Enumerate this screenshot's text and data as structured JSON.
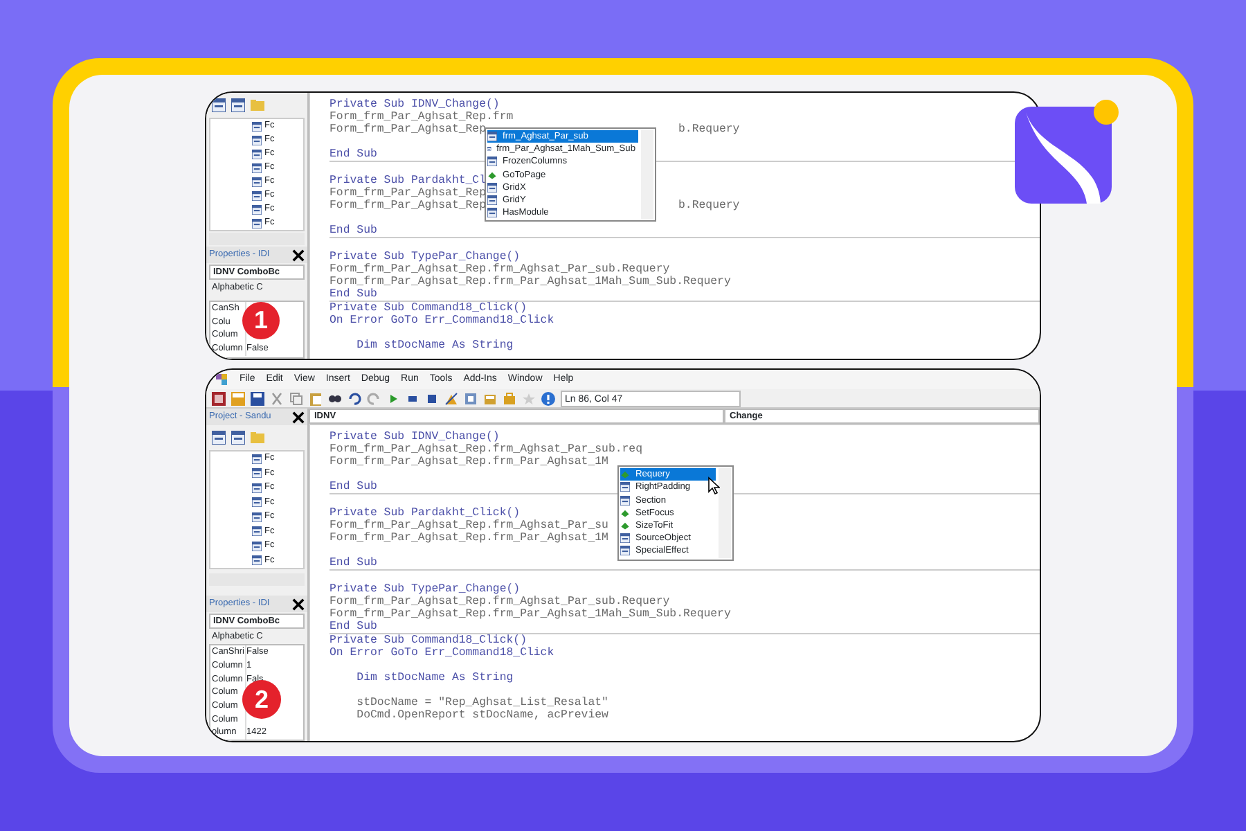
{
  "panels": [
    {
      "badge": "1",
      "tree": [
        "Fc",
        "Fc",
        "Fc",
        "Fc",
        "Fc",
        "Fc",
        "Fc",
        "Fc"
      ],
      "properties_title": "Properties - IDI",
      "properties_combo": "IDNV ComboBc",
      "properties_tab": "Alphabetic C",
      "properties": [
        {
          "name": "CanSh"
        },
        {
          "name": "Colu"
        },
        {
          "name": "Colum"
        },
        {
          "name": "Column",
          "value": "False"
        }
      ],
      "code": [
        [
          {
            "kind": "decl",
            "text": "Private Sub IDNV_Change()"
          },
          {
            "kind": "stmt",
            "text": "Form_frm_Par_Aghsat_Rep.frm"
          },
          {
            "kind": "stmt",
            "text": "Form_frm_Par_Aghsat_Rep",
            "tail": "b.Requery"
          },
          {
            "kind": "blank"
          },
          {
            "kind": "decl",
            "text": "End Sub"
          }
        ],
        [
          {
            "kind": "blank"
          },
          {
            "kind": "decl",
            "text": "Private Sub Pardakht_Cl"
          },
          {
            "kind": "stmt",
            "text": "Form_frm_Par_Aghsat_Rep"
          },
          {
            "kind": "stmt",
            "text": "Form_frm_Par_Aghsat_Rep",
            "tail": "b.Requery"
          },
          {
            "kind": "blank"
          },
          {
            "kind": "decl",
            "text": "End Sub"
          }
        ],
        [
          {
            "kind": "blank"
          },
          {
            "kind": "decl",
            "text": "Private Sub TypePar_Change()"
          },
          {
            "kind": "stmt",
            "text": "Form_frm_Par_Aghsat_Rep.frm_Aghsat_Par_sub.Requery"
          },
          {
            "kind": "stmt",
            "text": "Form_frm_Par_Aghsat_Rep.frm_Par_Aghsat_1Mah_Sum_Sub.Requery"
          },
          {
            "kind": "decl",
            "text": "End Sub"
          }
        ],
        [
          {
            "kind": "decl",
            "text": "Private Sub Command18_Click()"
          },
          {
            "kind": "decl",
            "text": "On Error GoTo Err_Command18_Click"
          },
          {
            "kind": "blank"
          },
          {
            "kind": "decl",
            "text": "    Dim stDocName As String"
          }
        ]
      ],
      "autocomplete": [
        {
          "label": "frm_Aghsat_Par_sub",
          "kind": "property",
          "selected": true
        },
        {
          "label": "frm_Par_Aghsat_1Mah_Sum_Sub",
          "kind": "property",
          "selected": false
        },
        {
          "label": "FrozenColumns",
          "kind": "property",
          "selected": false
        },
        {
          "label": "GoToPage",
          "kind": "method",
          "selected": false
        },
        {
          "label": "GridX",
          "kind": "property",
          "selected": false
        },
        {
          "label": "GridY",
          "kind": "property",
          "selected": false
        },
        {
          "label": "HasModule",
          "kind": "property",
          "selected": false
        }
      ]
    },
    {
      "badge": "2",
      "menu": [
        "File",
        "Edit",
        "View",
        "Insert",
        "Debug",
        "Run",
        "Tools",
        "Add-Ins",
        "Window",
        "Help"
      ],
      "position": "Ln 86, Col 47",
      "project_title": "Project - Sandu",
      "object_combo": "IDNV",
      "procedure_combo": "Change",
      "tree": [
        "Fc",
        "Fc",
        "Fc",
        "Fc",
        "Fc",
        "Fc",
        "Fc",
        "Fc"
      ],
      "properties_title": "Properties - IDI",
      "properties_combo": "IDNV ComboBc",
      "properties_tab": "Alphabetic C",
      "properties": [
        {
          "name": "CanShri",
          "value": "False"
        },
        {
          "name": "Column",
          "value": "1"
        },
        {
          "name": "Column",
          "value": "Fals"
        },
        {
          "name": "Colum"
        },
        {
          "name": "Colum"
        },
        {
          "name": "Colum"
        },
        {
          "name": "olumn",
          "value": "1422"
        }
      ],
      "code": [
        [
          {
            "kind": "decl",
            "text": "Private Sub IDNV_Change()"
          },
          {
            "kind": "stmt",
            "text": "Form_frm_Par_Aghsat_Rep.frm_Aghsat_Par_sub.req"
          },
          {
            "kind": "stmt",
            "text": "Form_frm_Par_Aghsat_Rep.frm_Par_Aghsat_1M"
          },
          {
            "kind": "blank"
          },
          {
            "kind": "decl",
            "text": "End Sub"
          }
        ],
        [
          {
            "kind": "blank"
          },
          {
            "kind": "decl",
            "text": "Private Sub Pardakht_Click()"
          },
          {
            "kind": "stmt",
            "text": "Form_frm_Par_Aghsat_Rep.frm_Aghsat_Par_su"
          },
          {
            "kind": "stmt",
            "text": "Form_frm_Par_Aghsat_Rep.frm_Par_Aghsat_1M"
          },
          {
            "kind": "blank"
          },
          {
            "kind": "decl",
            "text": "End Sub"
          }
        ],
        [
          {
            "kind": "blank"
          },
          {
            "kind": "decl",
            "text": "Private Sub TypePar_Change()"
          },
          {
            "kind": "stmt",
            "text": "Form_frm_Par_Aghsat_Rep.frm_Aghsat_Par_sub.Requery"
          },
          {
            "kind": "stmt",
            "text": "Form_frm_Par_Aghsat_Rep.frm_Par_Aghsat_1Mah_Sum_Sub.Requery"
          },
          {
            "kind": "decl",
            "text": "End Sub"
          }
        ],
        [
          {
            "kind": "decl",
            "text": "Private Sub Command18_Click()"
          },
          {
            "kind": "decl",
            "text": "On Error GoTo Err_Command18_Click"
          },
          {
            "kind": "blank"
          },
          {
            "kind": "decl",
            "text": "    Dim stDocName As String"
          },
          {
            "kind": "blank"
          },
          {
            "kind": "stmt",
            "text": "    stDocName = \"Rep_Aghsat_List_Resalat\""
          },
          {
            "kind": "stmt",
            "text": "    DoCmd.OpenReport stDocName, acPreview"
          }
        ]
      ],
      "autocomplete": [
        {
          "label": "Requery",
          "kind": "method",
          "selected": true
        },
        {
          "label": "RightPadding",
          "kind": "property",
          "selected": false
        },
        {
          "label": "Section",
          "kind": "property",
          "selected": false
        },
        {
          "label": "SetFocus",
          "kind": "method",
          "selected": false
        },
        {
          "label": "SizeToFit",
          "kind": "method",
          "selected": false
        },
        {
          "label": "SourceObject",
          "kind": "property",
          "selected": false
        },
        {
          "label": "SpecialEffect",
          "kind": "property",
          "selected": false
        }
      ]
    }
  ]
}
